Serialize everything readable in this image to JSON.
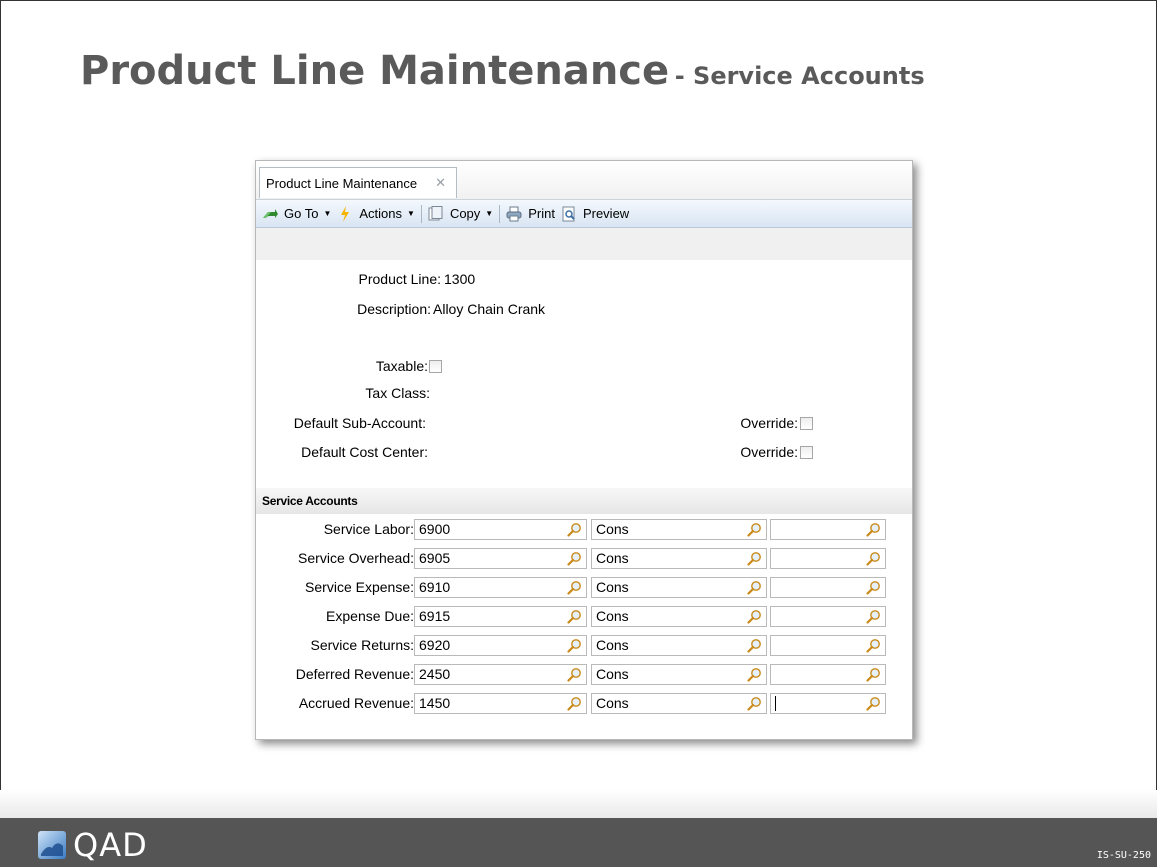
{
  "slide": {
    "title_main": "Product Line Maintenance",
    "title_sub": "- Service Accounts",
    "logo_text": "QAD",
    "slide_code": "IS-SU-250"
  },
  "window": {
    "tab_label": "Product Line Maintenance",
    "toolbar": {
      "goto": "Go To",
      "actions": "Actions",
      "copy": "Copy",
      "print": "Print",
      "preview": "Preview"
    }
  },
  "form": {
    "product_line_label": "Product Line:",
    "product_line_value": "1300",
    "description_label": "Description:",
    "description_value": "Alloy Chain Crank",
    "taxable_label": "Taxable:",
    "tax_class_label": "Tax Class:",
    "default_sub_account_label": "Default Sub-Account:",
    "default_cost_center_label": "Default Cost Center:",
    "override_label_1": "Override:",
    "override_label_2": "Override:"
  },
  "service_accounts": {
    "header": "Service Accounts",
    "rows": [
      {
        "label": "Service Labor:",
        "account": "6900",
        "sub": "Cons",
        "cc": ""
      },
      {
        "label": "Service Overhead:",
        "account": "6905",
        "sub": "Cons",
        "cc": ""
      },
      {
        "label": "Service Expense:",
        "account": "6910",
        "sub": "Cons",
        "cc": ""
      },
      {
        "label": "Expense Due:",
        "account": "6915",
        "sub": "Cons",
        "cc": ""
      },
      {
        "label": "Service Returns:",
        "account": "6920",
        "sub": "Cons",
        "cc": ""
      },
      {
        "label": "Deferred Revenue:",
        "account": "2450",
        "sub": "Cons",
        "cc": ""
      },
      {
        "label": "Accrued Revenue:",
        "account": "1450",
        "sub": "Cons",
        "cc": ""
      }
    ]
  }
}
